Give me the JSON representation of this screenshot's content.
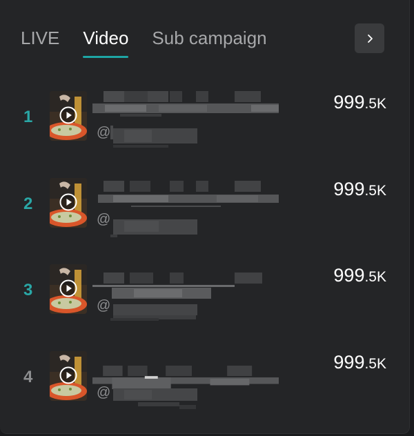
{
  "tabs": [
    {
      "label": "LIVE",
      "active": false
    },
    {
      "label": "Video",
      "active": true
    },
    {
      "label": "Sub campaign",
      "active": false
    }
  ],
  "next_icon": "chevron-right-icon",
  "colors": {
    "accent": "#1ea6a5",
    "rank_teal": "#2aa7a6",
    "rank_gray": "#8d8e90",
    "panel_bg": "#242527",
    "button_bg": "#3a3b3d"
  },
  "rows": [
    {
      "rank": "1",
      "handle_prefix": "@",
      "value_main": "999",
      "value_suffix": ".5K",
      "rank_color": "teal"
    },
    {
      "rank": "2",
      "handle_prefix": "@",
      "value_main": "999",
      "value_suffix": ".5K",
      "rank_color": "teal"
    },
    {
      "rank": "3",
      "handle_prefix": "@",
      "value_main": "999",
      "value_suffix": ".5K",
      "rank_color": "teal"
    },
    {
      "rank": "4",
      "handle_prefix": "@",
      "value_main": "999",
      "value_suffix": ".5K",
      "rank_color": "gray"
    }
  ]
}
